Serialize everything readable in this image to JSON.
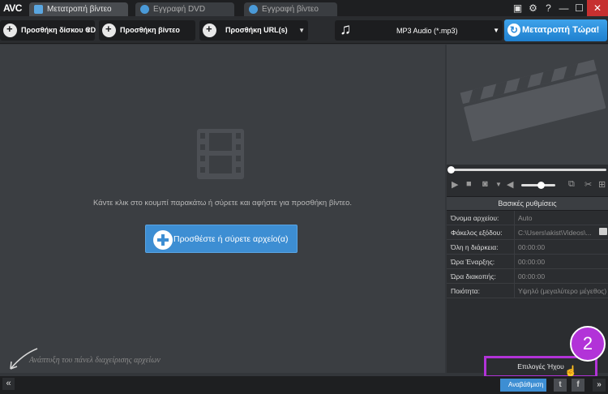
{
  "app": {
    "logo": "AVC"
  },
  "tabs": [
    {
      "label": "Μετατροπή βίντεο"
    },
    {
      "label": "Εγγραφή DVD"
    },
    {
      "label": "Εγγραφή βίντεο"
    }
  ],
  "window": {
    "help": "?",
    "minimize": "—",
    "maximize": "☐",
    "close": "✕"
  },
  "toolbar": {
    "add_cd": "Προσθήκη δίσκου CD",
    "add_video": "Προσθήκη βίντεο",
    "add_url": "Προσθήκη URL(s)",
    "format": "MP3 Audio (*.mp3)",
    "convert": "Μετατροπή Τώρα!"
  },
  "main": {
    "hint": "Κάντε κλικ στο κουμπί παρακάτω ή σύρετε και αφήστε για προσθήκη βίντεο.",
    "add_button": "Προσθέστε ή σύρετε αρχείο(α)",
    "expand_hint": "Ανάπτυξη του πάνελ διαχείρισης αρχείων"
  },
  "settings": {
    "title": "Βασικές ρυθμίσεις",
    "rows": [
      {
        "key": "Όνομα αρχείου:",
        "value": "Auto"
      },
      {
        "key": "Φάκελος εξόδου:",
        "value": "C:\\Users\\akist\\Videos\\..."
      },
      {
        "key": "Όλη η διάρκεια:",
        "value": "00:00:00"
      },
      {
        "key": "Ώρα Έναρξης:",
        "value": "00:00:00"
      },
      {
        "key": "Ώρα διακοπής:",
        "value": "00:00:00"
      },
      {
        "key": "Ποιότητα:",
        "value": "Υψηλό (μεγαλύτερο μέγεθος)"
      }
    ]
  },
  "audio_options": "Επιλογές Ήχου",
  "annotation_number": "2",
  "bottom": {
    "collapse": "«",
    "upgrade": "Αναβάθμιση",
    "expand": "»"
  },
  "colors": {
    "accent": "#3d8ed3",
    "highlight": "#b233d8",
    "close": "#c63030"
  }
}
